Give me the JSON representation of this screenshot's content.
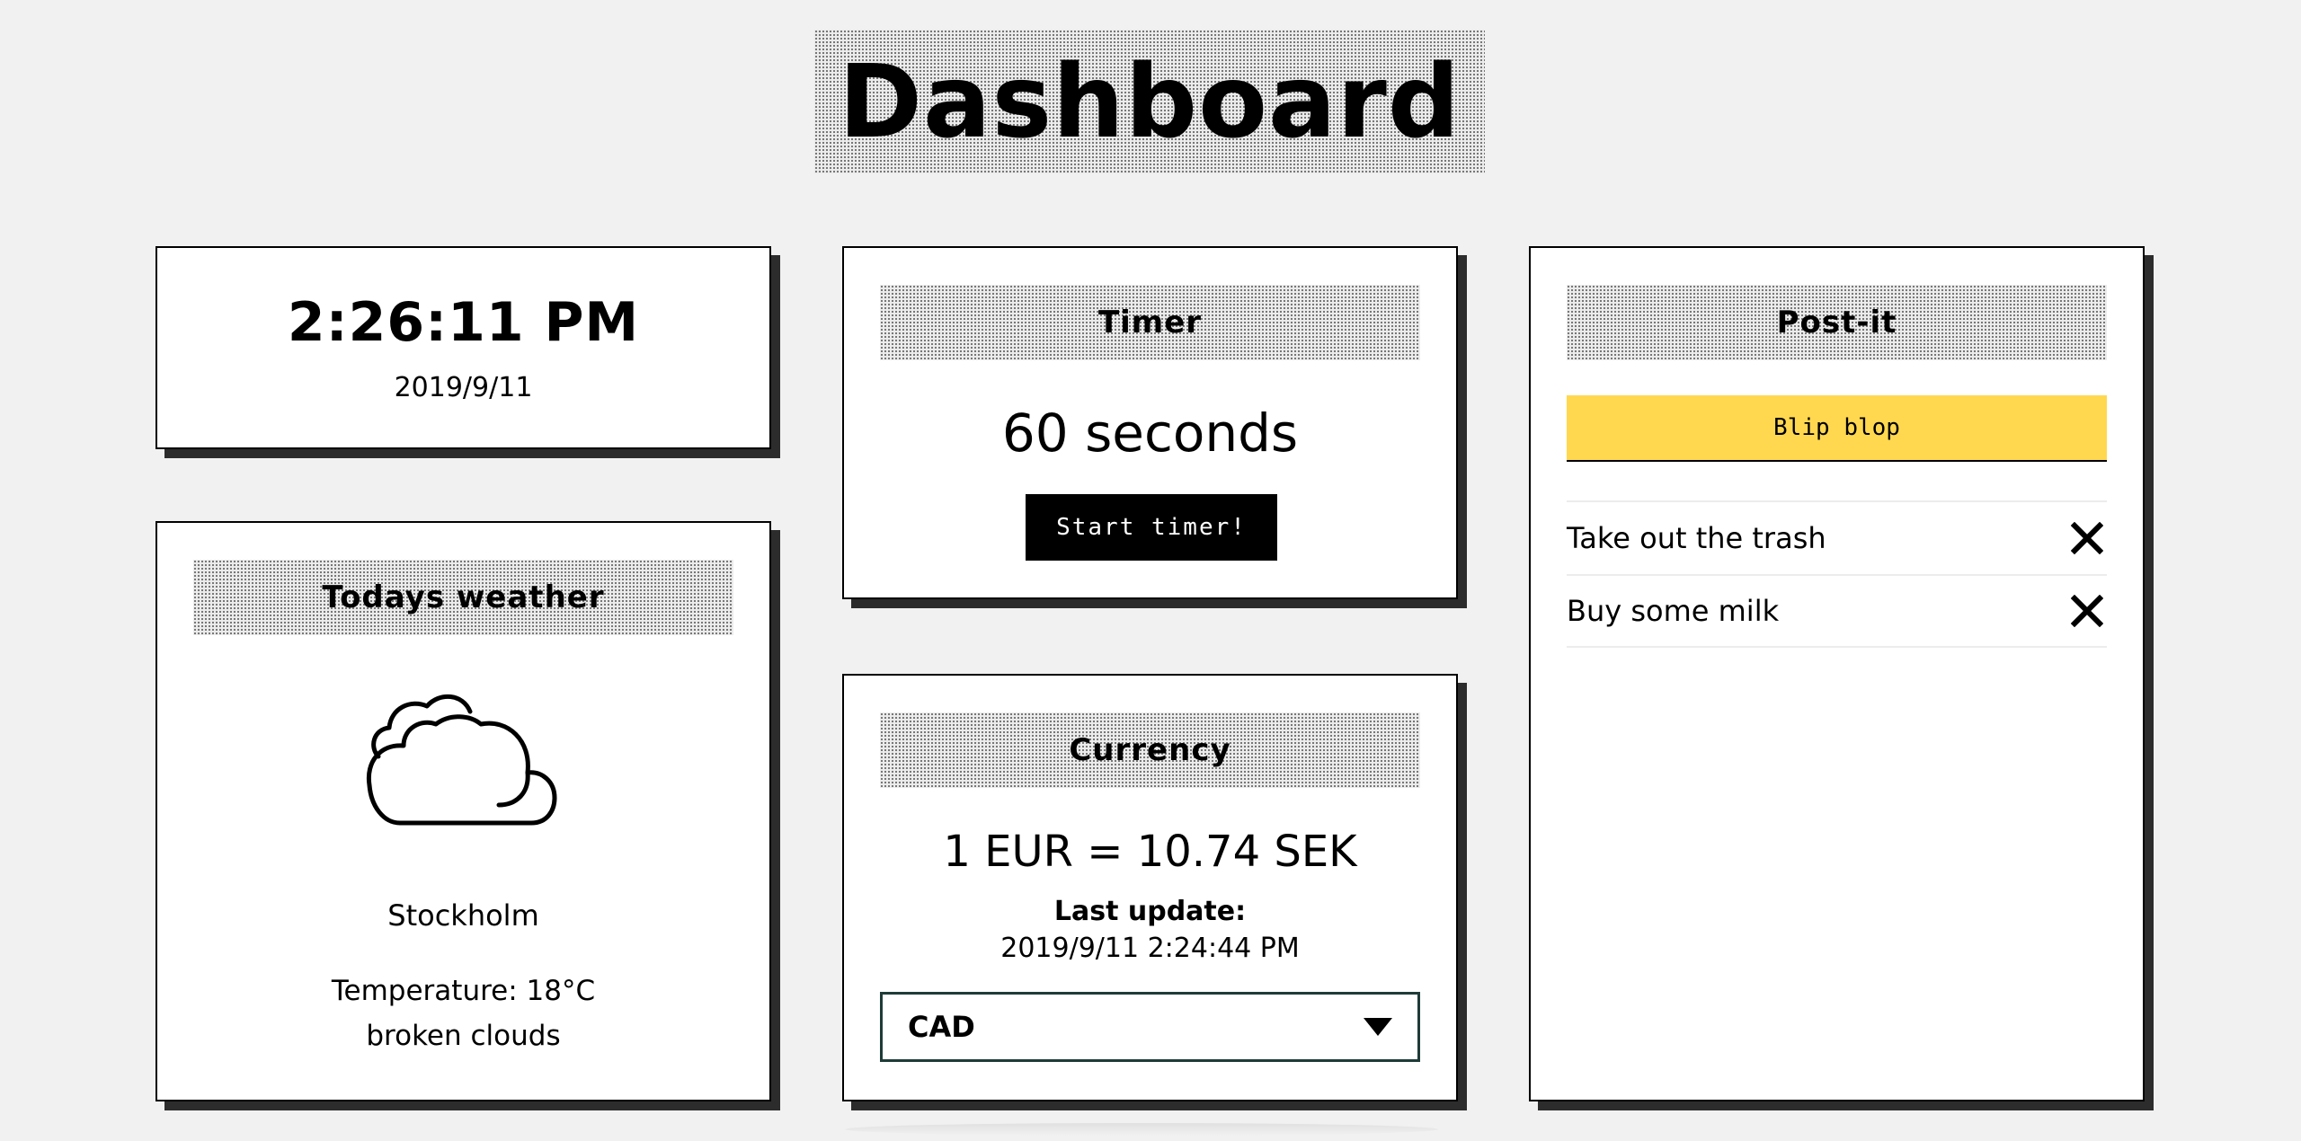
{
  "page": {
    "title": "Dashboard"
  },
  "clock": {
    "time": "2:26:11 PM",
    "date": "2019/9/11"
  },
  "weather": {
    "header": "Todays weather",
    "icon": "cloud-icon",
    "city": "Stockholm",
    "temperature": "Temperature: 18°C",
    "description": "broken clouds"
  },
  "timer": {
    "header": "Timer",
    "display": "60 seconds",
    "start_label": "Start timer!"
  },
  "currency": {
    "header": "Currency",
    "rate": "1 EUR = 10.74 SEK",
    "last_update_label": "Last update:",
    "last_update_value": "2019/9/11 2:24:44 PM",
    "selected": "CAD"
  },
  "postit": {
    "header": "Post-it",
    "input_value": "Blip blop",
    "items": [
      {
        "text": "Take out the trash",
        "remove_icon": "close-icon"
      },
      {
        "text": "Buy some milk",
        "remove_icon": "close-icon"
      }
    ]
  },
  "colors": {
    "background": "#f1f1f1",
    "postit_yellow": "#ffd84f",
    "select_border": "#1e3b38",
    "card_shadow": "#2c2c2c"
  }
}
